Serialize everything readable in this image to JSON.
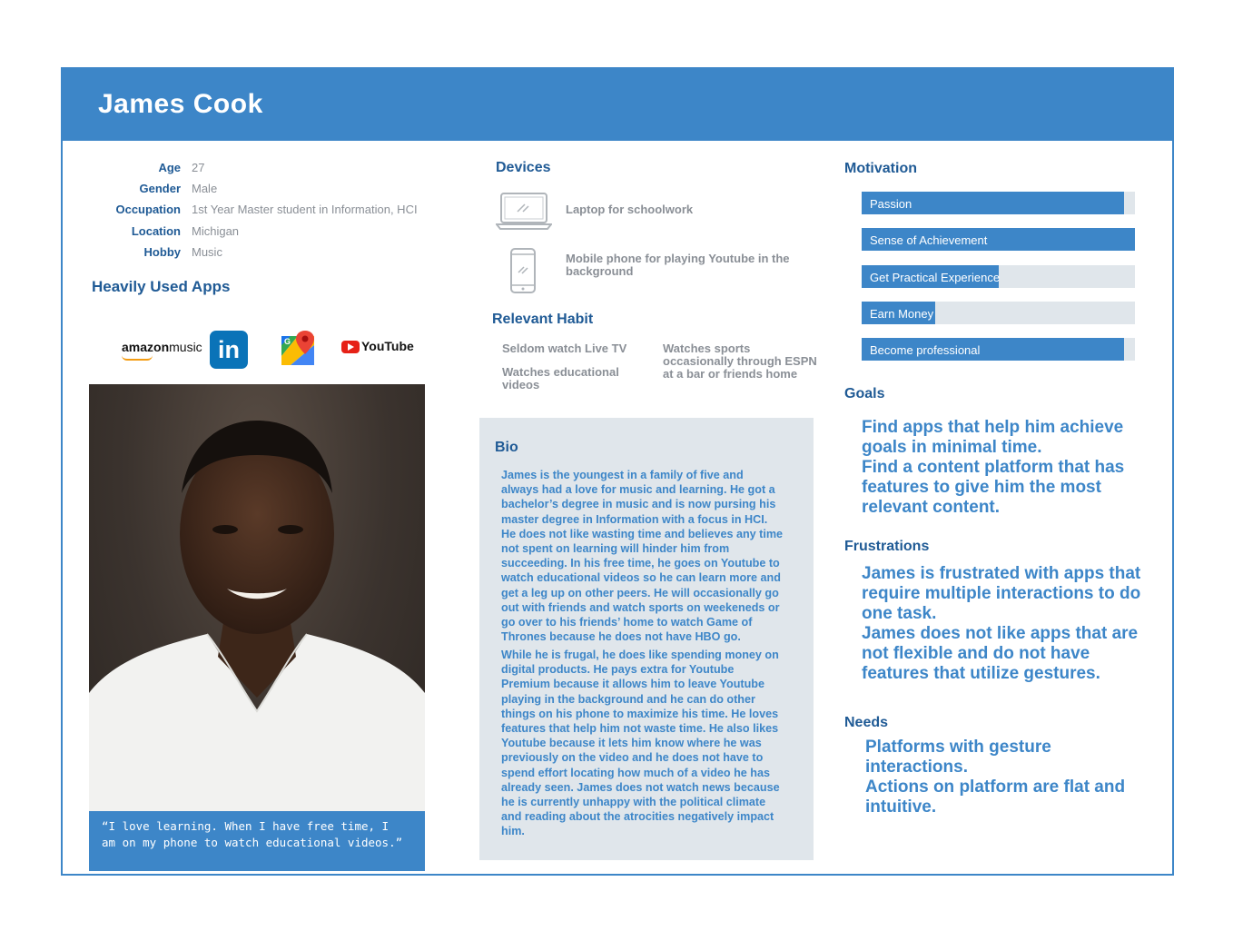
{
  "header": {
    "name": "James Cook"
  },
  "profile": {
    "rows": [
      {
        "label": "Age",
        "value": "27"
      },
      {
        "label": "Gender",
        "value": "Male"
      },
      {
        "label": "Occupation",
        "value": "1st Year Master student in Information, HCI"
      },
      {
        "label": "Location",
        "value": "Michigan"
      },
      {
        "label": "Hobby",
        "value": "Music"
      }
    ],
    "apps_title": "Heavily Used  Apps",
    "apps": {
      "amazon_brand": "amazon",
      "amazon_music": "music",
      "linkedin": "in",
      "youtube": "YouTube"
    },
    "quote_line1": "“I love learning. When I have free time, I",
    "quote_line2": "am on my phone to watch educational videos.”"
  },
  "devices": {
    "title": "Devices",
    "laptop": "Laptop for schoolwork",
    "phone_line1": "Mobile phone for playing Youtube in the",
    "phone_line2": "background"
  },
  "habit": {
    "title": "Relevant Habit",
    "h1": "Seldom watch Live TV",
    "h2_line1": "Watches educational",
    "h2_line2": "videos",
    "h3_line1": "Watches sports",
    "h3_line2": "occasionally through ESPN",
    "h3_line3": "at a bar or friends home"
  },
  "bio": {
    "title": "Bio",
    "p1": [
      "James is the youngest in a family of five and",
      "always had a love for music and learning. He got a",
      "bachelor’s degree in music and is now pursing his",
      "master degree in Information with a focus in HCI.",
      "He does not like wasting time and believes any time",
      "not spent on learning will hinder him from",
      "succeeding. In his free time, he goes on Youtube to",
      "watch educational videos so he can learn more and",
      "get a leg up on other peers. He will occasionally go",
      "out with friends and watch sports on weekeneds or",
      "go over to his friends’ home to watch Game of",
      "Thrones because he does not have HBO go."
    ],
    "p2": [
      "While he is frugal, he does like spending money on",
      "digital products. He pays extra for Youtube",
      "Premium because it allows him to leave Youtube",
      "playing in the background and he can do other",
      "things on his phone to maximize his time. He loves",
      "features that help him not waste time. He also likes",
      "Youtube because it lets him know where he was",
      "previously on the video and he does not have to",
      "spend effort locating how much of a video he has",
      "already seen. James does not watch news because",
      "he is currently unhappy with the political climate",
      "and reading about the atrocities negatively impact",
      "him."
    ]
  },
  "motivation": {
    "title": "Motivation",
    "bars": [
      {
        "label": "Passion",
        "level": 0.96
      },
      {
        "label": "Sense of Achievement",
        "level": 1.0
      },
      {
        "label": "Get Practical Experience",
        "level": 0.5
      },
      {
        "label": "Earn Money",
        "level": 0.27
      },
      {
        "label": "Become professional",
        "level": 0.96
      }
    ]
  },
  "goals": {
    "title": "Goals",
    "lines": [
      "Find apps that help him achieve",
      "goals in minimal time.",
      "Find a content platform that has",
      "features to give him the most",
      "relevant content."
    ]
  },
  "frustrations": {
    "title": "Frustrations",
    "lines": [
      "James is frustrated with apps that",
      "require multiple interactions to do",
      "one task.",
      "James does not like apps that are",
      "not flexible and do not have",
      "features that utilize gestures."
    ]
  },
  "needs": {
    "title": "Needs",
    "lines": [
      "Platforms with gesture",
      "interactions.",
      "Actions on platform are flat and",
      "intuitive."
    ]
  },
  "colors": {
    "accent": "#3d86c8",
    "heading": "#1f5a95",
    "muted": "#8a8f96",
    "panel": "#e0e6eb"
  }
}
